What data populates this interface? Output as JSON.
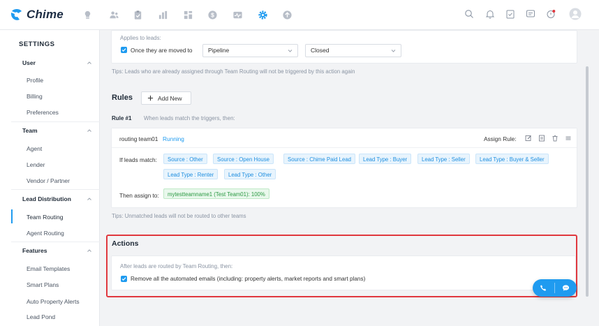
{
  "brand": {
    "name": "Chime",
    "color": "#1f9bf0"
  },
  "top_nav_icons": [
    "lightbulb-icon",
    "people-icon",
    "clipboard-icon",
    "bar-chart-icon",
    "grid-icon",
    "dollar-icon",
    "pulse-icon",
    "gear-icon",
    "upload-icon"
  ],
  "top_right_icons": [
    "search-icon",
    "bell-icon",
    "checklist-icon",
    "message-icon",
    "notification-icon",
    "avatar-icon"
  ],
  "sidebar": {
    "title": "SETTINGS",
    "groups": [
      {
        "label": "User",
        "items": [
          "Profile",
          "Billing",
          "Preferences"
        ]
      },
      {
        "label": "Team",
        "items": [
          "Agent",
          "Lender",
          "Vendor / Partner"
        ]
      },
      {
        "label": "Lead Distribution",
        "items": [
          "Team Routing",
          "Agent Routing"
        ]
      },
      {
        "label": "Features",
        "items": [
          "Email Templates",
          "Smart Plans",
          "Auto Property Alerts",
          "Lead Pond"
        ]
      }
    ],
    "active_item": "Team Routing"
  },
  "applies": {
    "label": "Applies to leads:",
    "checkbox_label": "Once they are moved to",
    "pipeline_value": "Pipeline",
    "stage_value": "Closed"
  },
  "tips1": "Tips: Leads who are already assigned through Team Routing will not be triggered by this action again",
  "rules": {
    "title": "Rules",
    "add_new": "Add New",
    "rule_label": "Rule #1",
    "rule_desc": "When leads match the triggers, then:",
    "rule_name": "routing team01",
    "status": "Running",
    "assign_rule_label": "Assign Rule:",
    "if_match_label": "If leads match:",
    "tags": [
      "Source : Other",
      "Source : Open House",
      "Source : Chime Paid Lead",
      "Lead Type : Buyer",
      "Lead Type : Seller",
      "Lead Type : Buyer & Seller",
      "Lead Type : Renter",
      "Lead Type : Other"
    ],
    "then_assign_label": "Then assign to:",
    "assignee": "mytestteamname1 (Test Team01): 100%"
  },
  "tips2": "Tips: Unmatched leads will not be routed to other teams",
  "actions": {
    "title": "Actions",
    "desc": "After leads are routed by Team Routing, then:",
    "checkbox_label": "Remove all the automated emails (including: property alerts, market reports and smart plans)"
  }
}
